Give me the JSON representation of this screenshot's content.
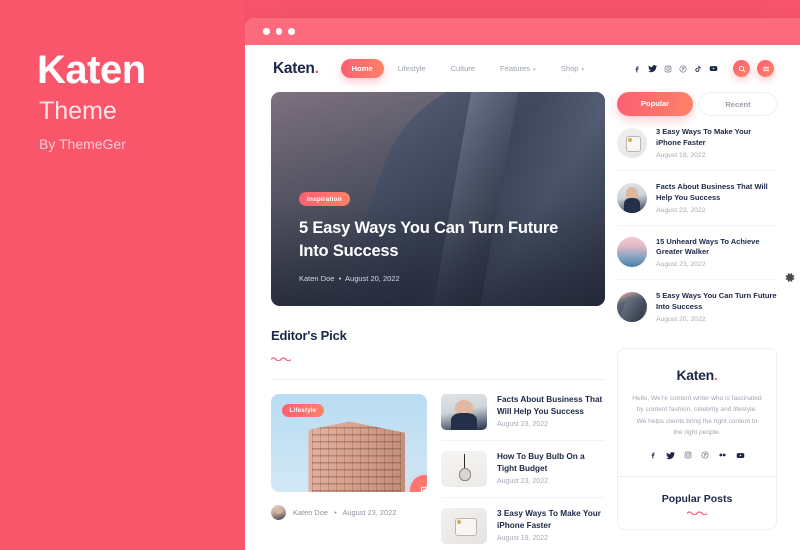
{
  "promo": {
    "title": "Katen",
    "subtitle": "Theme",
    "byline": "By ThemeGer",
    "background_color": "#f9566c"
  },
  "brand": {
    "accent": "#f9566c",
    "accent_gradient_start": "#fb5f72",
    "accent_gradient_end": "#fd8267",
    "dark_text": "#1d2746",
    "muted_text": "#a4a9b4"
  },
  "window": {
    "chrome_color": "#fb6a7d",
    "traffic_lights": [
      "dot-1",
      "dot-2",
      "dot-3"
    ]
  },
  "nav": {
    "logo": "Katen",
    "logo_dot": ".",
    "items": [
      {
        "label": "Home",
        "active": true,
        "has_caret": false
      },
      {
        "label": "Lifestyle",
        "active": false,
        "has_caret": false
      },
      {
        "label": "Culture",
        "active": false,
        "has_caret": false
      },
      {
        "label": "Features",
        "active": false,
        "has_caret": true
      },
      {
        "label": "Shop",
        "active": false,
        "has_caret": true
      }
    ],
    "socials": [
      "facebook-icon",
      "twitter-icon",
      "instagram-icon",
      "pinterest-icon",
      "tiktok-icon",
      "youtube-icon"
    ],
    "actions": [
      "search-icon",
      "hamburger-menu-icon"
    ]
  },
  "hero": {
    "category": "Inspiration",
    "title": "5 Easy Ways You Can Turn Future Into Success",
    "author": "Katen Doe",
    "separator": "•",
    "date": "August 20, 2022"
  },
  "editors_pick": {
    "heading": "Editor's Pick",
    "featured": {
      "category": "Lifestyle",
      "author": "Katen Doe",
      "separator": "•",
      "date": "August 23, 2022",
      "fab_icon": "gallery-icon"
    },
    "items": [
      {
        "title": "Facts About Business That Will Help You Success",
        "date": "August 23, 2022",
        "thumb": "woman"
      },
      {
        "title": "How To Buy Bulb On a Tight Budget",
        "date": "August 23, 2022",
        "thumb": "bulb"
      },
      {
        "title": "3 Easy Ways To Make Your iPhone Faster",
        "date": "August 19, 2022",
        "thumb": "phone"
      }
    ]
  },
  "sidebar": {
    "tabs": [
      {
        "label": "Popular",
        "active": true
      },
      {
        "label": "Recent",
        "active": false
      }
    ],
    "posts": [
      {
        "title": "3 Easy Ways To Make Your iPhone Faster",
        "date": "August 19, 2022",
        "thumb": "phone"
      },
      {
        "title": "Facts About Business That Will Help You Success",
        "date": "August 23, 2022",
        "thumb": "woman"
      },
      {
        "title": "15 Unheard Ways To Achieve Greater Walker",
        "date": "August 23, 2022",
        "thumb": "sky"
      },
      {
        "title": "5 Easy Ways You Can Turn Future Into Success",
        "date": "August 20, 2022",
        "thumb": "tower"
      }
    ],
    "about": {
      "logo": "Katen",
      "logo_dot": ".",
      "text": "Hello, We're content writer who is fascinated by content fashion, celebrity and lifestyle. We helps clients bring the right content to the right people.",
      "socials": [
        "facebook-icon",
        "twitter-icon",
        "instagram-icon",
        "pinterest-icon",
        "flickr-icon",
        "youtube-icon"
      ]
    },
    "popular_posts_heading": "Popular Posts"
  },
  "mini_window": {
    "chrome_color": "#fb6a7d",
    "hero": {
      "category": "Inspiration",
      "title": "5 Easy Ways You Can Turn Future Into Success",
      "author": "Katen Doe",
      "separator": "•",
      "date": "August 20, 2022"
    },
    "tabs": [
      {
        "label": "Popular",
        "active": true
      },
      {
        "label": "Recent",
        "active": false
      }
    ],
    "post": {
      "title": "3 Easy Ways To Make Your iPhone Faster",
      "date": "August 19, 2022"
    }
  },
  "edge": {
    "gear_icon": "gear-icon"
  }
}
